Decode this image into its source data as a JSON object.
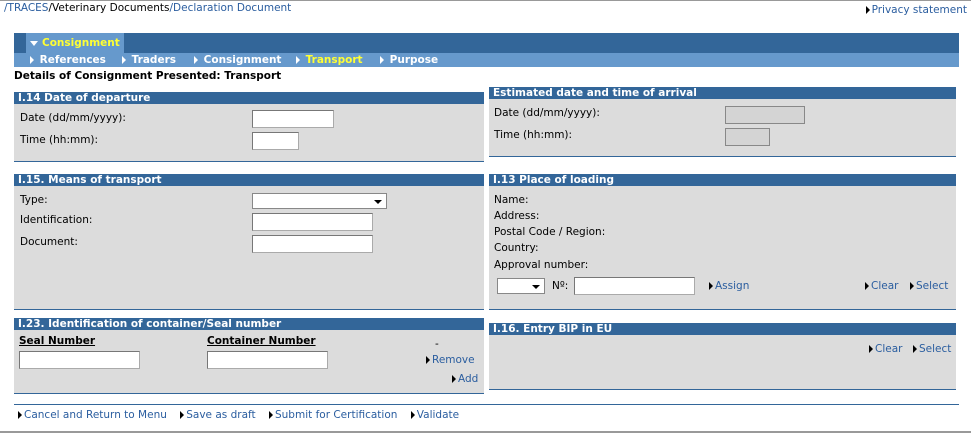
{
  "breadcrumb": {
    "sep": "/",
    "root": "TRACES",
    "section": "Veterinary Documents",
    "current": "Declaration Document"
  },
  "privacy": "Privacy statement",
  "tab": "Consignment",
  "subnav": [
    "References",
    "Traders",
    "Consignment",
    "Transport",
    "Purpose"
  ],
  "page_title": "Details of Consignment Presented: Transport",
  "departure": {
    "title": "I.14 Date of departure",
    "date_label": "Date (dd/mm/yyyy):",
    "time_label": "Time (hh:mm):"
  },
  "arrival": {
    "title": "Estimated date and time of arrival",
    "date_label": "Date (dd/mm/yyyy):",
    "time_label": "Time (hh:mm):"
  },
  "transport": {
    "title": "I.15. Means of transport",
    "type_label": "Type:",
    "id_label": "Identification:",
    "doc_label": "Document:"
  },
  "loading": {
    "title": "I.13 Place of loading",
    "name_label": "Name:",
    "address_label": "Address:",
    "postal_label": "Postal Code / Region:",
    "country_label": "Country:",
    "approval_label": "Approval number:",
    "no_label": "Nº:",
    "assign": "Assign",
    "clear": "Clear",
    "select": "Select"
  },
  "container": {
    "title": "I.23. Identification of container/Seal number",
    "seal_header": "Seal Number",
    "container_header": "Container Number",
    "dash": "-",
    "remove": "Remove",
    "add": "Add"
  },
  "bip": {
    "title": "I.16. Entry BIP in EU",
    "clear": "Clear",
    "select": "Select"
  },
  "footer": [
    "Cancel and Return to Menu",
    "Save as draft",
    "Submit for Certification",
    "Validate"
  ]
}
